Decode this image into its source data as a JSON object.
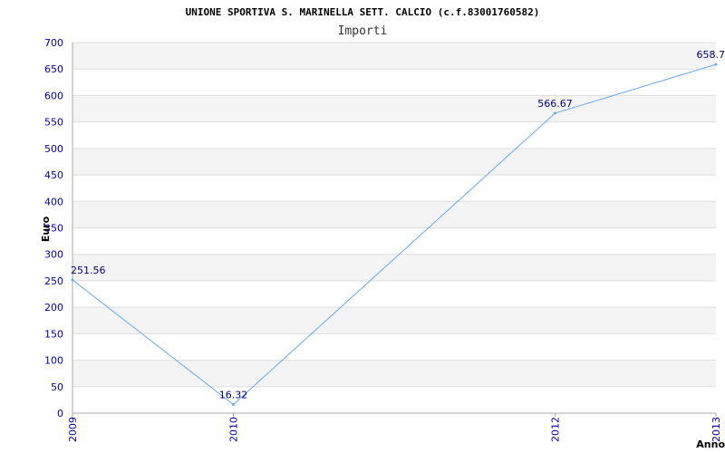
{
  "chart_data": {
    "type": "line",
    "title": "UNIONE SPORTIVA S. MARINELLA SETT. CALCIO (c.f.83001760582)",
    "subtitle": "Importi",
    "xlabel": "Anno",
    "ylabel": "Euro",
    "ylim": [
      0,
      700
    ],
    "yticks": [
      0,
      50,
      100,
      150,
      200,
      250,
      300,
      350,
      400,
      450,
      500,
      550,
      600,
      650,
      700
    ],
    "x": [
      2009,
      2010,
      2012,
      2013
    ],
    "xtick_labels": [
      "2009",
      "2010",
      "2012",
      "2013"
    ],
    "series": [
      {
        "values": [
          251.56,
          16.32,
          566.67,
          658.7
        ],
        "labels": [
          "251.56",
          "16.32",
          "566.67",
          "658.7"
        ],
        "color": "#66aaee"
      }
    ],
    "grid": true,
    "band_colors": [
      "#f4f4f4",
      "#ffffff"
    ]
  }
}
